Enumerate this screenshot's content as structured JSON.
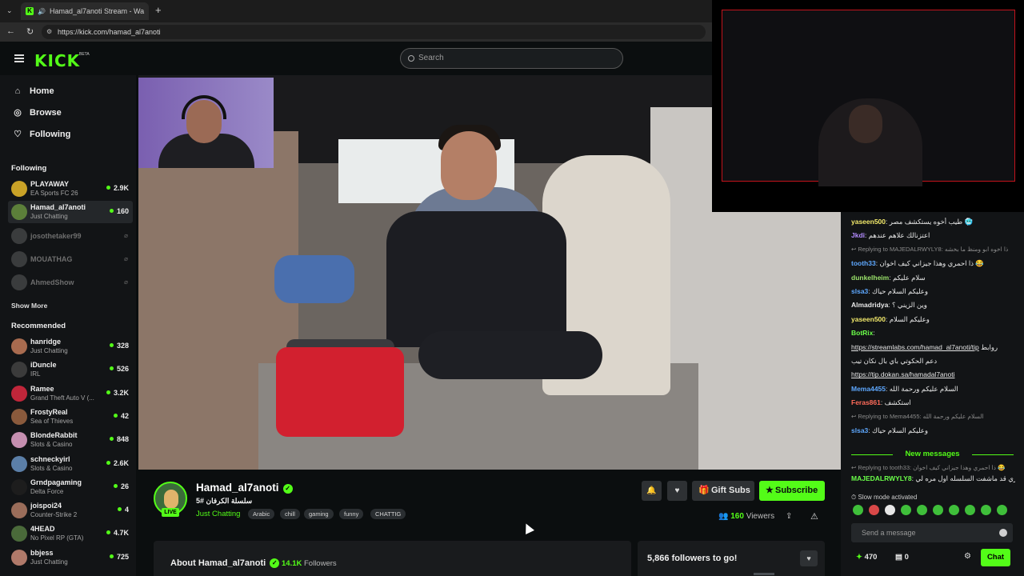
{
  "browser": {
    "tab_title": "Hamad_al7anoti Stream - Wa",
    "url": "https://kick.com/hamad_al7anoti"
  },
  "header": {
    "logo": "KICK",
    "beta": "BETA",
    "search_placeholder": "Search"
  },
  "sidebar": {
    "nav": [
      {
        "label": "Home",
        "icon": "home-icon"
      },
      {
        "label": "Browse",
        "icon": "compass-icon"
      },
      {
        "label": "Following",
        "icon": "heart-icon"
      }
    ],
    "following_title": "Following",
    "following": [
      {
        "name": "PLAYAWAY",
        "game": "EA Sports FC 26",
        "viewers": "2.9K",
        "color": "#c9a227"
      },
      {
        "name": "Hamad_al7anoti",
        "game": "Just Chatting",
        "viewers": "160",
        "color": "#5c7f3a"
      },
      {
        "name": "josothetaker99",
        "offline": true,
        "color": "#777"
      },
      {
        "name": "MOUATHAG",
        "offline": true,
        "color": "#777"
      },
      {
        "name": "AhmedShow",
        "offline": true,
        "color": "#777"
      }
    ],
    "show_more": "Show More",
    "recommended_title": "Recommended",
    "recommended": [
      {
        "name": "hanridge",
        "game": "Just Chatting",
        "viewers": "328",
        "color": "#a86b4f"
      },
      {
        "name": "iDuncle",
        "game": "IRL",
        "viewers": "526",
        "color": "#3b3b3b"
      },
      {
        "name": "Ramee",
        "game": "Grand Theft Auto V (...",
        "viewers": "3.2K",
        "color": "#c0263a"
      },
      {
        "name": "FrostyReal",
        "game": "Sea of Thieves",
        "viewers": "42",
        "color": "#8a5a3c"
      },
      {
        "name": "BlondeRabbit",
        "game": "Slots & Casino",
        "viewers": "848",
        "color": "#c58fb0"
      },
      {
        "name": "schneckyirl",
        "game": "Slots & Casino",
        "viewers": "2.6K",
        "color": "#5b7fa8"
      },
      {
        "name": "Grndpagaming",
        "game": "Delta Force",
        "viewers": "26",
        "color": "#1d1d1d"
      },
      {
        "name": "joispoi24",
        "game": "Counter-Strike 2",
        "viewers": "4",
        "color": "#9a6d5a"
      },
      {
        "name": "4HEAD",
        "game": "No Pixel RP (GTA)",
        "viewers": "4.7K",
        "color": "#4a6a3a"
      },
      {
        "name": "bbjess",
        "game": "Just Chatting",
        "viewers": "725",
        "color": "#b07a6a"
      }
    ]
  },
  "stream": {
    "streamer": "Hamad_al7anoti",
    "live_label": "LIVE",
    "title": "سلسلة الكرفان #5",
    "category": "Just Chatting",
    "tags": [
      "Arabic",
      "chill",
      "gaming",
      "funny",
      "CHATTIG"
    ],
    "gift_label": "Gift Subs",
    "subscribe_label": "Subscribe",
    "viewers_count": "160",
    "viewers_label": "Viewers",
    "about_label": "About Hamad_al7anoti",
    "followers_count": "14.1K",
    "followers_label": "Followers",
    "goal_label": "5,866 followers to go!"
  },
  "chat": {
    "messages": [
      {
        "user": "yaseen500",
        "color": "#f2e96b",
        "text": "طيب أخوه يستكشف مصر 🥶"
      },
      {
        "user": "Jkdi",
        "color": "#b38cff",
        "text": "اعتزنالك علاهم عندهم"
      },
      {
        "reply": "Replying to MAJEDALRWYLY8: ذا اخوه ابو ومنظ ما بخشه"
      },
      {
        "user": "tooth33",
        "color": "#5ea8ff",
        "text": "ذا احمري وهذا جيزاني كيف اخوان 😂"
      },
      {
        "user": "dunkelheim",
        "color": "#9be36b",
        "text": "سلام عليكم"
      },
      {
        "user": "slsa3",
        "color": "#5ea8ff",
        "text": "وعليكم السلام حياك"
      },
      {
        "user": "Almadridya",
        "color": "#e9e9e9",
        "text": "وين الزيني ؟"
      },
      {
        "user": "yaseen500",
        "color": "#f2e96b",
        "text": "وعليكم السلام"
      },
      {
        "user": "BotRix",
        "color": "#6bff4a",
        "text": ""
      },
      {
        "link1": "https://streamlabs.com/hamad_al7anoti/tip",
        "link1_suffix": "روابط"
      },
      {
        "plain": "دعم الحكوتي باي بال نكان تيب"
      },
      {
        "link2": "https://tip.dokan.sa/hamadal7anoti"
      },
      {
        "user": "Mema4455",
        "color": "#5ea8ff",
        "text": "السلام عليكم ورحمة الله"
      },
      {
        "user": "Feras861",
        "color": "#ff6b5a",
        "text": "استكشف"
      },
      {
        "reply": "Replying to Mema4455: السلام عليكم ورحمة الله"
      },
      {
        "user": "slsa3",
        "color": "#5ea8ff",
        "text": "وعليكم السلام حياك"
      }
    ],
    "new_messages": "New messages",
    "after": [
      {
        "reply": "Replying to tooth33: ذا احمري وهذا جيزاني كيف اخوان 😂"
      },
      {
        "user": "MAJEDALRWYLY8",
        "color": "#6bff4a",
        "text": "مدري قد ماشفت السلسله اول مره لي"
      }
    ],
    "slow_mode": "Slow mode activated",
    "input_placeholder": "Send a message",
    "points": "470",
    "points2": "0",
    "chat_button": "Chat"
  }
}
